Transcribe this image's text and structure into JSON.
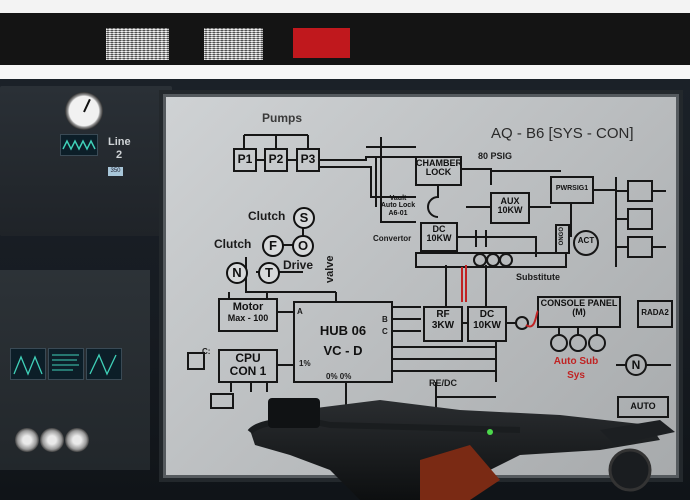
{
  "colors": {
    "accent_red": "#c0181d",
    "board_bg": "#c4c7c9",
    "screen_green": "#3fd0b8",
    "wire_red": "#c02323"
  },
  "console": {
    "line_label": "Line",
    "line_number": "2",
    "lcd_value": "350"
  },
  "diagram": {
    "title": "AQ - B6 [SYS - CON]",
    "pumps_label": "Pumps",
    "pumps": [
      "P1",
      "P2",
      "P3"
    ],
    "psig": "80 PSIG",
    "chamber_lock": [
      "CHAMBER",
      "LOCK"
    ],
    "vault": [
      "Vault",
      "Auto Lock",
      "A6-01"
    ],
    "convertor": "Convertor",
    "aux": [
      "AUX",
      "10KW"
    ],
    "pwrsig": "PWRSIG1",
    "act": "ACT",
    "ongo": "ONGO",
    "dc_top": [
      "DC",
      "10KW"
    ],
    "substitute": "Substitute",
    "clutch1": "Clutch",
    "clutch2": "Clutch",
    "s": "S",
    "f": "F",
    "o": "O",
    "n": "N",
    "t": "T",
    "drive": "Drive",
    "valve": "valve",
    "motor": [
      "Motor",
      "Max - 100"
    ],
    "hub": [
      "HUB 06",
      "VC - D"
    ],
    "hub_ports_left": [
      "A"
    ],
    "hub_ports_right": [
      "B",
      "C"
    ],
    "hub_percent": "1%",
    "hub_bottom": "0% 0%",
    "cpu": [
      "CPU",
      "CON 1"
    ],
    "c_label": "C:",
    "rf": [
      "RF",
      "3KW"
    ],
    "dc_mid": [
      "DC",
      "10KW"
    ],
    "console_panel": [
      "CONSOLE PANEL",
      "(M)"
    ],
    "rada": "RADA2",
    "auto_sub": [
      "Auto Sub",
      "Sys"
    ],
    "n_circle": "N",
    "refdc": "RE/DC",
    "auto": "AUTO"
  }
}
